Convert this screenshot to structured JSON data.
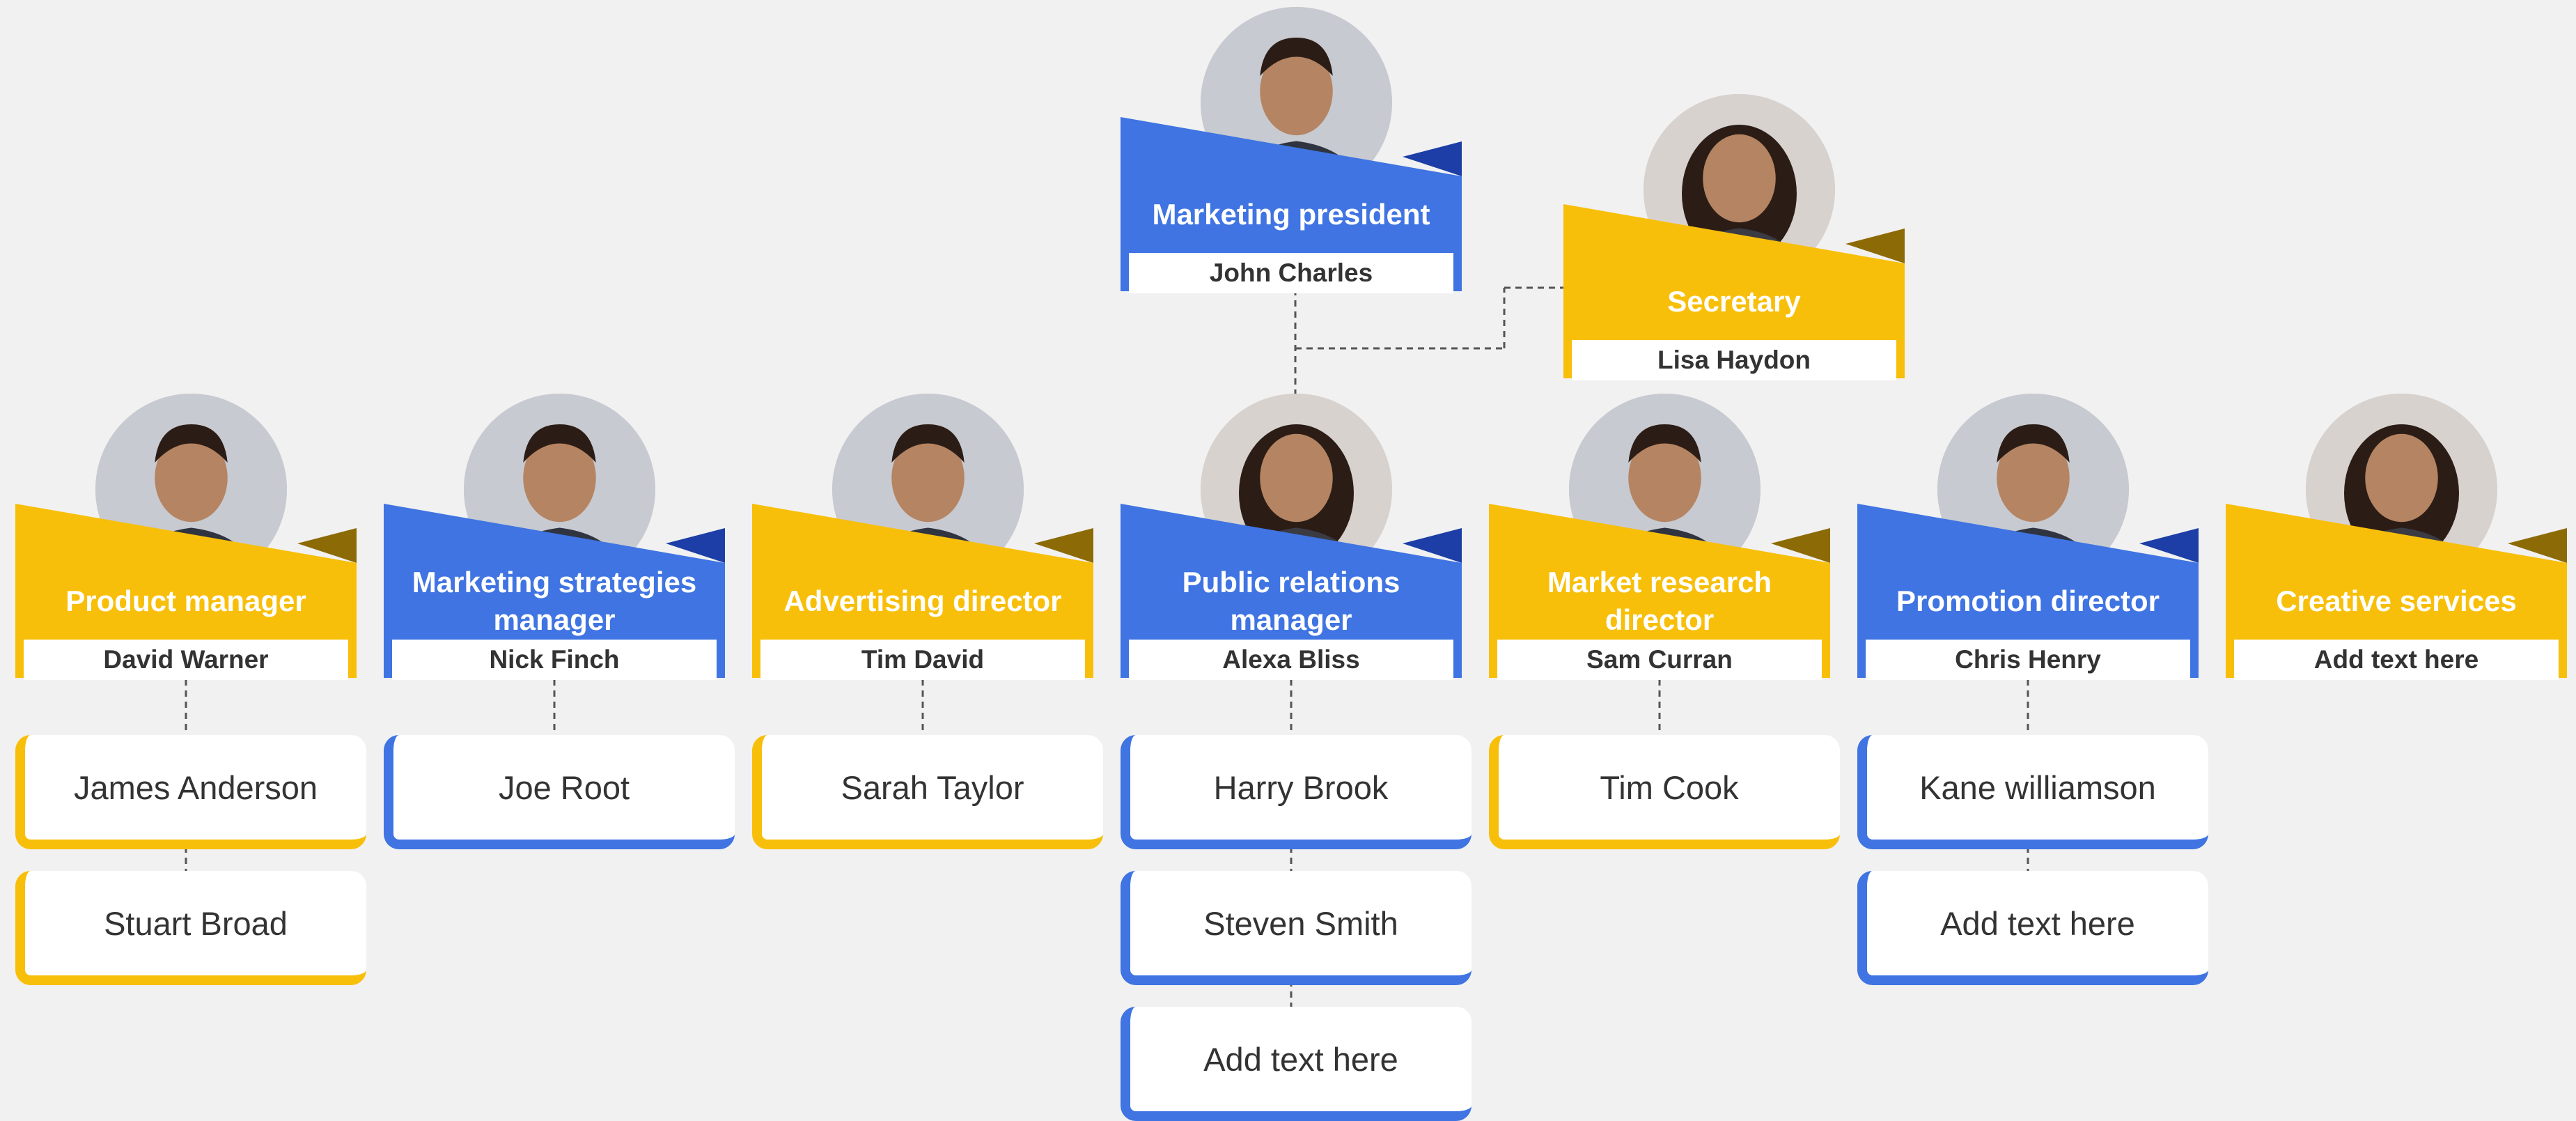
{
  "colors": {
    "blue": "#3f74e2",
    "blue_dark": "#1c3ea6",
    "yellow": "#f8bf0a",
    "yellow_dark": "#8c6a05",
    "background": "#f1f1f1"
  },
  "top": {
    "title": "Marketing president",
    "name": "John Charles",
    "color": "blue",
    "avatar": "man-portrait-icon"
  },
  "secretary": {
    "title": "Secretary",
    "name": "Lisa Haydon",
    "color": "yellow",
    "avatar": "woman-portrait-icon"
  },
  "managers": [
    {
      "title": "Product manager",
      "name": "David Warner",
      "color": "yellow",
      "avatar": "man-portrait-icon",
      "reports": [
        "James Anderson",
        "Stuart Broad"
      ]
    },
    {
      "title": "Marketing strategies manager",
      "name": "Nick Finch",
      "color": "blue",
      "avatar": "man-portrait-icon",
      "reports": [
        "Joe Root"
      ]
    },
    {
      "title": "Advertising director",
      "name": "Tim David",
      "color": "yellow",
      "avatar": "man-portrait-icon",
      "reports": [
        "Sarah Taylor"
      ]
    },
    {
      "title": "Public relations manager",
      "name": "Alexa Bliss",
      "color": "blue",
      "avatar": "woman-portrait-icon",
      "reports": [
        "Harry Brook",
        "Steven Smith",
        "Add text here"
      ]
    },
    {
      "title": "Market research director",
      "name": "Sam Curran",
      "color": "yellow",
      "avatar": "man-portrait-icon",
      "reports": [
        "Tim Cook"
      ]
    },
    {
      "title": "Promotion director",
      "name": "Chris Henry",
      "color": "blue",
      "avatar": "man-portrait-icon",
      "reports": [
        "Kane williamson",
        "Add text here"
      ]
    },
    {
      "title": "Creative services",
      "name": "Add text here",
      "color": "yellow",
      "avatar": "woman-portrait-icon",
      "reports": []
    }
  ]
}
